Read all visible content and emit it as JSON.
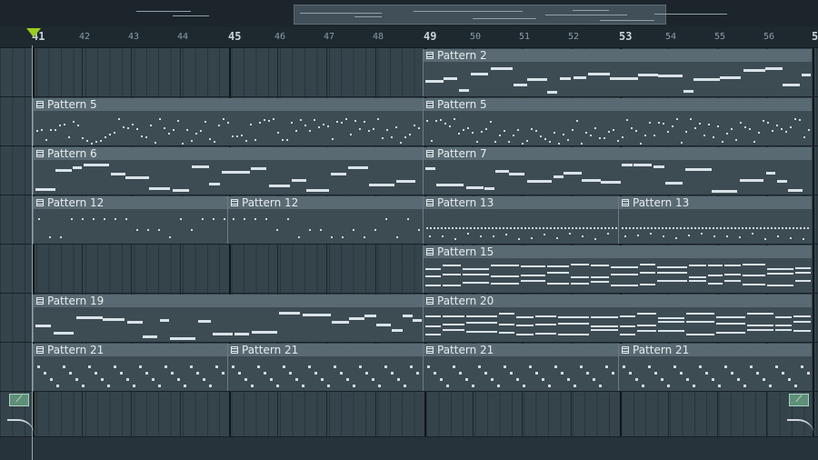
{
  "overview": {
    "label": "playlist-overview"
  },
  "ruler": {
    "labels": [
      {
        "text": "41",
        "bar": true
      },
      {
        "text": "42",
        "bar": false
      },
      {
        "text": "43",
        "bar": false
      },
      {
        "text": "44",
        "bar": false
      },
      {
        "text": "45",
        "bar": true
      },
      {
        "text": "46",
        "bar": false
      },
      {
        "text": "47",
        "bar": false
      },
      {
        "text": "48",
        "bar": false
      },
      {
        "text": "49",
        "bar": true
      },
      {
        "text": "50",
        "bar": false
      },
      {
        "text": "51",
        "bar": false
      },
      {
        "text": "52",
        "bar": false
      },
      {
        "text": "53",
        "bar": true
      },
      {
        "text": "54",
        "bar": false
      },
      {
        "text": "55",
        "bar": false
      },
      {
        "text": "56",
        "bar": false
      },
      {
        "text": "5",
        "bar": true
      }
    ]
  },
  "tracks": [
    {
      "clips": [
        {
          "title": "Pattern 2",
          "style": "melody"
        }
      ]
    },
    {
      "clips": [
        {
          "title": "Pattern 5",
          "style": "dots"
        },
        {
          "title": "Pattern 5",
          "style": "dots"
        }
      ]
    },
    {
      "clips": [
        {
          "title": "Pattern 6",
          "style": "melody"
        },
        {
          "title": "Pattern 7",
          "style": "melody"
        }
      ]
    },
    {
      "clips": [
        {
          "title": "Pattern 12",
          "style": "sparse"
        },
        {
          "title": "Pattern 12",
          "style": "sparse"
        },
        {
          "title": "Pattern 13",
          "style": "dense"
        },
        {
          "title": "Pattern 13",
          "style": "dense"
        }
      ]
    },
    {
      "clips": [
        {
          "title": "Pattern 15",
          "style": "chords"
        }
      ]
    },
    {
      "clips": [
        {
          "title": "Pattern 19",
          "style": "melody"
        },
        {
          "title": "Pattern 20",
          "style": "chords"
        }
      ]
    },
    {
      "clips": [
        {
          "title": "Pattern 21",
          "style": "stairs"
        },
        {
          "title": "Pattern 21",
          "style": "stairs"
        },
        {
          "title": "Pattern 21",
          "style": "stairs"
        },
        {
          "title": "Pattern 21",
          "style": "stairs"
        }
      ]
    },
    {
      "clips": []
    }
  ],
  "automation": {
    "icon": "automation-clip-icon"
  },
  "colors": {
    "background": "#27333b",
    "clip_header": "#5a6a72",
    "note": "#d9e3e7",
    "playhead": "#9acb1f"
  }
}
